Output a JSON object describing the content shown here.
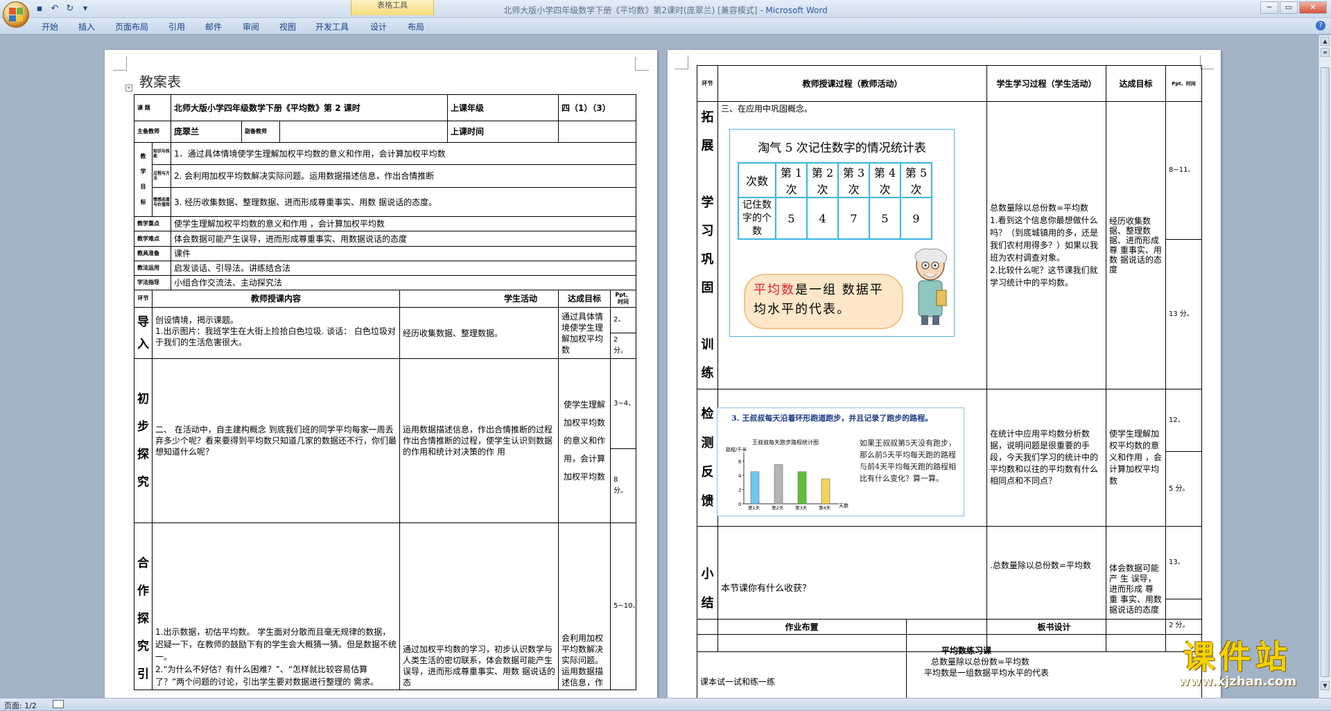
{
  "window": {
    "title": "北师大版小学四年级数学下册《平均数》第2课时(庞翠兰) [兼容模式] - ",
    "app_name": "Microsoft Word",
    "context_tab_group": "表格工具",
    "controls": {
      "minimize": "─",
      "maximize": "▭",
      "close": "✕"
    }
  },
  "ribbon": {
    "tabs": [
      "开始",
      "插入",
      "页面布局",
      "引用",
      "邮件",
      "审阅",
      "视图",
      "开发工具",
      "设计",
      "布局"
    ],
    "help": "?"
  },
  "page1": {
    "heading": "教案表",
    "header_rows": {
      "topic_label": "课  题",
      "topic_value": "北师大版小学四年级数学下册《平均数》第 2 课时",
      "grade_label": "上课年级",
      "grade_value": "四（1）（3）",
      "main_teacher_label": "主备教师",
      "main_teacher_value": "庞翠兰",
      "assistant_label": "副备教师",
      "assistant_value": "",
      "time_label": "上课时间",
      "goals_label": [
        "教",
        "学",
        "目",
        "标"
      ],
      "goal_sub_labels": [
        "知识与技能",
        "过程与方法",
        "情感态度与价值观"
      ],
      "goals": [
        "1．通过具体情境使学生理解加权平均数的意义和作用，会计算加权平均数",
        "2. 会利用加权平均数解决实际问题。运用数据描述信息，作出合情推断",
        "3. 经历收集数据、整理数据、进而形成尊重事实、用数 据说话的态度。"
      ],
      "key_label": "教学重点",
      "key_value": "使学生理解加权平均数的意义和作用 ，会计算加权平均数",
      "difficulty_label": "教学难点",
      "difficulty_value": "体会数据可能产生误导，进而形成尊重事实、用数据说话的态度",
      "prep_label": "教具准备",
      "prep_value": "课件",
      "method_label": "教法运用",
      "method_value": "启发谈话、引导法。讲练结合法",
      "guidance_label": "学法指导",
      "guidance_value": "小组合作交流法、主动探究法"
    },
    "columns": [
      "环节",
      "教师授课内容",
      "学生活动",
      "达成目标",
      "Ppt、时间"
    ],
    "rows": [
      {
        "stage": [
          "导",
          "入"
        ],
        "content": "创设情境，揭示课题。\n  1.出示图片：我班学生在大街上捡拾白色垃圾. 谈话： 白色垃圾对于我们的生活危害很大。",
        "activity": "经历收集数据、整理数据。",
        "goal": "通过具体情境使学生理解加权平均数",
        "ppt": [
          "2、",
          "2 分。"
        ]
      },
      {
        "stage": [
          "初",
          "步",
          "探",
          "究"
        ],
        "content": "  二、 在活动中，自主建构概念 到底我们班的同学平均每家一周丢弃多少个呢？看来要得到平均数只知道几家的数据还不行，你们最想知道什么呢？",
        "activity": "运用数据描述信息，作出合情推断的过程\n作出合情推断的过程，使学生认识到数据的作用和统计对决策的作 用",
        "goal": "使学生理解加权平均数的意义和作用，会计算加权平均数",
        "ppt": [
          "3~4、",
          "8 分。"
        ]
      },
      {
        "stage": [
          "合",
          "作",
          "探",
          "究",
          "引"
        ],
        "content": "  1.出示数据，初估平均数。 学生面对分散而且毫无规律的数据，迟疑一下，在教师的鼓励下有的学生会大概猜一猜。但是数据不统一。\n  2.“为什么不好估？有什么困难？”、“怎样就比较容易估算了？”两个问题的讨论，引出学生要对数据进行整理的 需求。",
        "activity": "通过加权平均数的学习，初步认识数学与人类生活的密切联系，体会数据可能产生误导，进而形成尊重事实、用数 据说话的态",
        "goal": "会利用加权平均数解决实际问题。运用数据描述信息，作",
        "ppt": [
          "5~10、",
          ""
        ]
      }
    ]
  },
  "page2": {
    "columns": [
      "环节",
      "教师授课过程（教师活动）",
      "学生学习过程（学生活动）",
      "达成目标",
      "Ppt、时间"
    ],
    "rows": [
      {
        "stage": [
          "拓",
          "展",
          "学",
          "习",
          "巩",
          "固",
          "训",
          "练"
        ],
        "content": "三、在应用中巩固概念。",
        "activity": "  总数量除以总份数=平均数\n  1.看到这个信息你最想做什么吗？（到底城镇用的多，还是我们农村用得多？）如果以我班为农村调查对象。\n  2.比较什么呢？这节课我们就学习统计中的平均数。",
        "goal": "经历收集数据、整理数据、进而形成尊 重事实、用数 据说话的态度",
        "ppt": [
          "8~11、",
          "13 分。"
        ]
      },
      {
        "stage": [
          "检",
          "测",
          "反",
          "馈"
        ],
        "content": "",
        "activity": "在统计中应用平均数分析数据，说明问题是很重要的手段，今天我们学习的统计中的平均数和以往的平均数有什么 相同点和不同点？",
        "goal": "使学生理解加权平均数的意义和作用 ，会计算加权平均数",
        "ppt": [
          "12、",
          "5 分。"
        ]
      },
      {
        "stage": [
          "小",
          "结"
        ],
        "content": "本节课你有什么收获？",
        "activity": ".总数量除以总份数=平均数",
        "goal": "体会数据可能 产 生 误导，进而形成 尊 重 事实、用数据说话的态度",
        "ppt": [
          "13、",
          "2 分。"
        ]
      }
    ],
    "homework_label": "作业布置",
    "board_label": "板书设计",
    "homework_value": "课本试一试和练一练",
    "board_lines": [
      "平均数练习课",
      "总数量除以总份数=平均数",
      "平均数是一组数据平均水平的代表"
    ],
    "figure1": {
      "title": "淘气 5 次记住数字的情况统计表",
      "header": [
        "次数",
        "第 1 次",
        "第 2 次",
        "第 3 次",
        "第 4 次",
        "第 5 次"
      ],
      "row_label": "记住数字的个数",
      "row_values": [
        "5",
        "4",
        "7",
        "5",
        "9"
      ],
      "bubble_highlight": "平均数",
      "bubble_text": "是一组 数据平均水平的代表。"
    },
    "figure2": {
      "problem": "3. 王叔叔每天沿着环形跑道跑步，并且记录了跑步的路程。",
      "note": "如果王叔叔第5天没有跑步，那么前5天平均每天跑的路程与前4天平均每天跑的路程相比有什么变化？算一算。"
    }
  },
  "chart_data": {
    "type": "bar",
    "title": "王叔叔每天跑步路程统计图",
    "ylabel": "路程/千米",
    "xlabel": "天数",
    "categories": [
      "第1天",
      "第2天",
      "第3天",
      "第4天"
    ],
    "values": [
      4.5,
      5.5,
      4.5,
      3.5
    ],
    "ylim": [
      0,
      7
    ],
    "yticks": [
      "0",
      "2",
      "4",
      "6"
    ],
    "colors": [
      "#6ec6f0",
      "#b5b5b5",
      "#5fbf3a",
      "#f2d35a"
    ],
    "grid": false
  },
  "status_bar": {
    "page": "页面: 1/2"
  },
  "watermark": {
    "big": "课件站",
    "url": "www.kjzhan.com"
  }
}
